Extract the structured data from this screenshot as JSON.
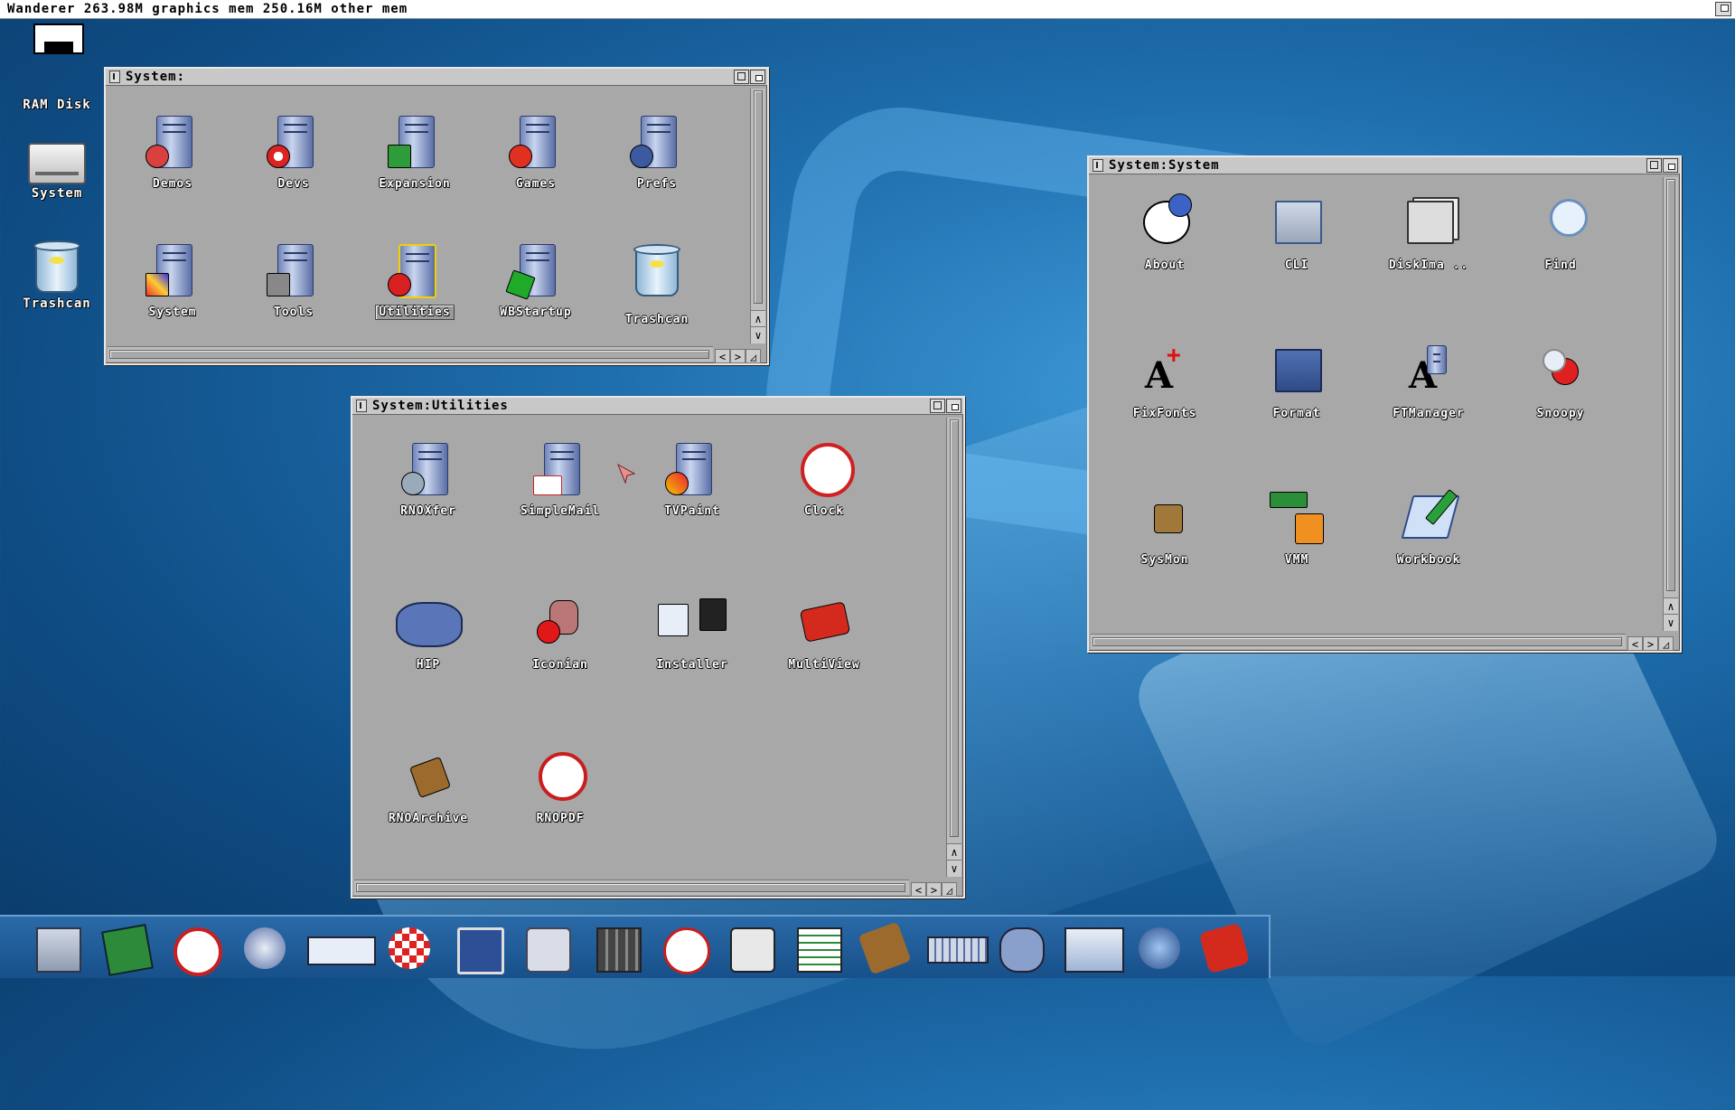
{
  "screen_title": "Wanderer 263.98M graphics mem 250.16M other mem",
  "desktop_icons": [
    {
      "label": ""
    },
    {
      "label": "RAM Disk"
    },
    {
      "label": "System"
    },
    {
      "label": "Trashcan"
    }
  ],
  "win_system": {
    "title": "System:",
    "icons": [
      {
        "label": "Demos"
      },
      {
        "label": "Devs"
      },
      {
        "label": "Expansion"
      },
      {
        "label": "Games"
      },
      {
        "label": "Prefs"
      },
      {
        "label": "System"
      },
      {
        "label": "Tools"
      },
      {
        "label": "Utilities",
        "selected": true
      },
      {
        "label": "WBStartup"
      },
      {
        "label": "Trashcan"
      }
    ]
  },
  "win_utilities": {
    "title": "System:Utilities",
    "icons": [
      {
        "label": "RNOXfer"
      },
      {
        "label": "SimpleMail"
      },
      {
        "label": "TVPaint"
      },
      {
        "label": "Clock"
      },
      {
        "label": "HIP"
      },
      {
        "label": "Iconian"
      },
      {
        "label": "Installer"
      },
      {
        "label": "MultiView"
      },
      {
        "label": "RNOArchive"
      },
      {
        "label": "RNOPDF"
      }
    ]
  },
  "win_syssys": {
    "title": "System:System",
    "icons": [
      {
        "label": "About"
      },
      {
        "label": "CLI"
      },
      {
        "label": "DiskIma .."
      },
      {
        "label": "Find"
      },
      {
        "label": "FixFonts"
      },
      {
        "label": "Format"
      },
      {
        "label": "FTManager"
      },
      {
        "label": "Snoopy"
      },
      {
        "label": "SysMon"
      },
      {
        "label": "VMM"
      },
      {
        "label": "Workbook"
      }
    ]
  },
  "scroll_arrows": {
    "up": "∧",
    "down": "∨",
    "left": "<",
    "right": ">"
  },
  "dock_items": [
    {
      "icon": "shell-icon"
    },
    {
      "icon": "notepad-icon"
    },
    {
      "icon": "clock-icon"
    },
    {
      "icon": "network-transfer-icon"
    },
    {
      "icon": "panel-icon"
    },
    {
      "icon": "boing-ball-help-icon"
    },
    {
      "icon": "monitor-search-icon"
    },
    {
      "icon": "magnifier-icon"
    },
    {
      "icon": "calculator-icon"
    },
    {
      "icon": "pdf-icon"
    },
    {
      "icon": "inote-icon"
    },
    {
      "icon": "spreadsheet-icon"
    },
    {
      "icon": "archive-icon"
    },
    {
      "icon": "keyboard-icon"
    },
    {
      "icon": "hippo-icon"
    },
    {
      "icon": "weather-icon"
    },
    {
      "icon": "network-globe-icon"
    },
    {
      "icon": "multiview-icon"
    }
  ],
  "colors": {
    "desktop": "#1f6fae",
    "window": "#a8a8a8",
    "dock": "#1f5a96"
  }
}
